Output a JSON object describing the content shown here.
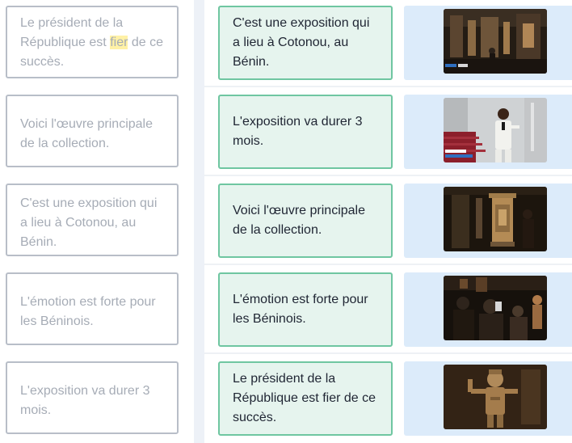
{
  "sources": [
    {
      "before": "Le président de la République est ",
      "highlight": "fier",
      "after": " de ce succès."
    },
    {
      "before": "Voici l'œuvre principale de la collection.",
      "highlight": "",
      "after": ""
    },
    {
      "before": "C'est une exposition qui a lieu à Cotonou, au Bénin.",
      "highlight": "",
      "after": ""
    },
    {
      "before": "L'émotion est forte pour les Béninois.",
      "highlight": "",
      "after": ""
    },
    {
      "before": "L'exposition va durer 3 mois.",
      "highlight": "",
      "after": ""
    }
  ],
  "targets": [
    "C'est une exposition qui a lieu à Cotonou, au Bénin.",
    "L'exposition va durer 3 mois.",
    "Voici l'œuvre principale de la collection.",
    "L'émotion est forte pour les Béninois.",
    "Le président de la République est fier de ce succès."
  ],
  "thumbnails": [
    {
      "icon": "video-thumbnail-exhibition-hall"
    },
    {
      "icon": "video-thumbnail-president-speaking"
    },
    {
      "icon": "video-thumbnail-royal-throne"
    },
    {
      "icon": "video-thumbnail-visitors-photographing"
    },
    {
      "icon": "video-thumbnail-royal-statue"
    }
  ],
  "colors": {
    "highlight": "#fff1a6",
    "target_border": "#6fc6a1",
    "target_bg": "#e6f4ee",
    "source_border": "#b8bec8",
    "media_bg": "#dcebfa"
  }
}
